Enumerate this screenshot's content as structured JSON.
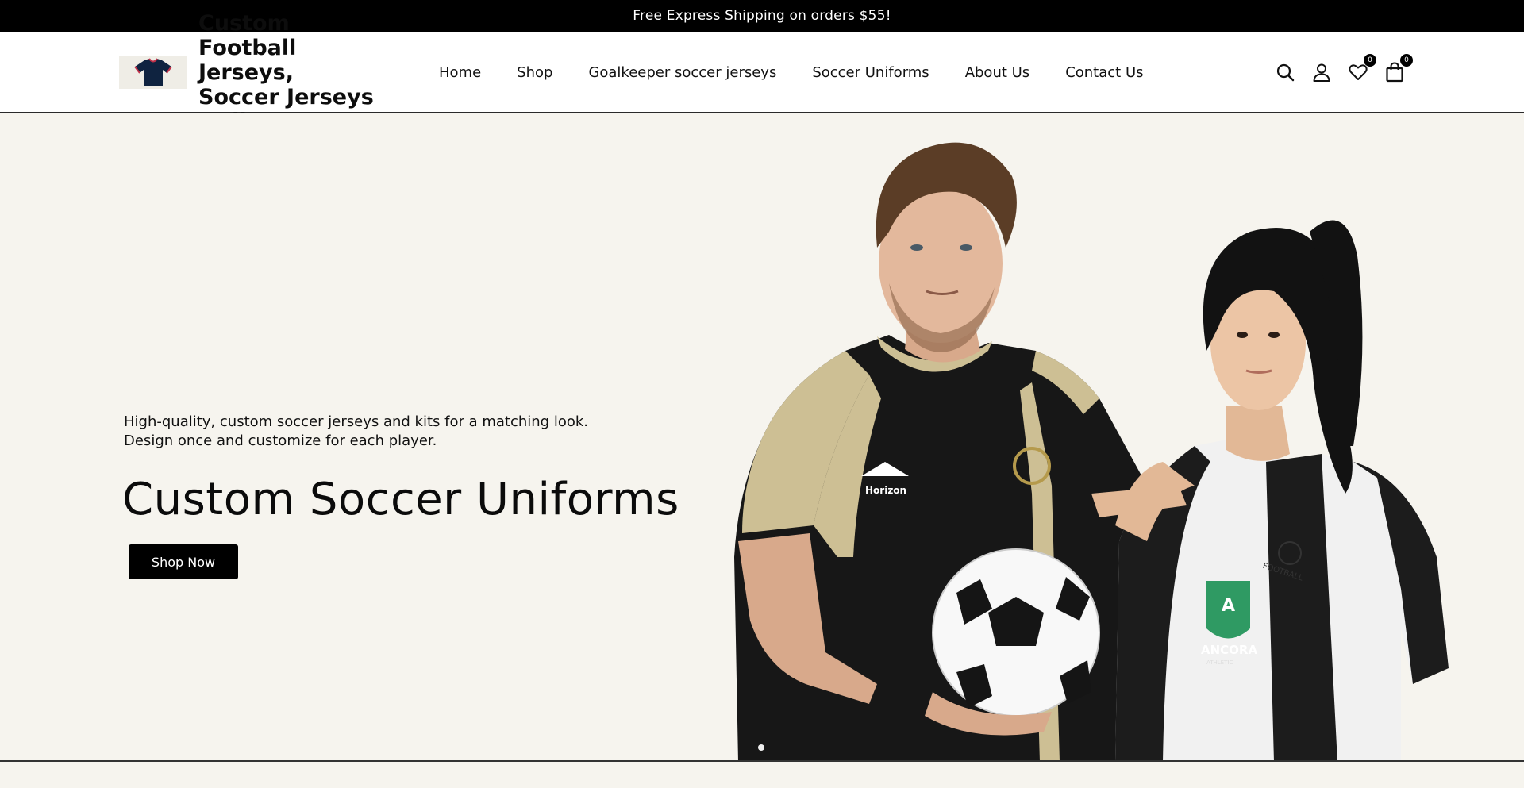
{
  "announcement": {
    "text": "Free Express Shipping on orders $55!"
  },
  "header": {
    "logo_text": "Custom Football Jerseys, Soccer Jerseys Online",
    "nav": [
      {
        "label": "Home"
      },
      {
        "label": "Shop"
      },
      {
        "label": "Goalkeeper soccer jerseys"
      },
      {
        "label": "Soccer Uniforms"
      },
      {
        "label": "About Us"
      },
      {
        "label": "Contact Us"
      }
    ],
    "icons": {
      "search": "search-icon",
      "account": "user-icon",
      "wishlist": "heart-icon",
      "cart": "bag-icon"
    },
    "wishlist_count": "0",
    "cart_count": "0"
  },
  "hero": {
    "subtitle_line1": "High-quality, custom soccer jerseys and kits for a matching look.",
    "subtitle_line2": "Design once and customize for each player.",
    "title": "Custom Soccer Uniforms",
    "cta_label": "Shop Now",
    "jersey_left": {
      "sponsor": "Horizon"
    },
    "jersey_right": {
      "badge_letter": "A",
      "badge_name": "ANCORA",
      "badge_sub": "ATHLETIC",
      "chest_text": "FOOTBALL"
    }
  },
  "colors": {
    "announcement_bg": "#000000",
    "hero_bg": "#f6f4ee",
    "button_bg": "#000000",
    "jersey_gold": "#cdbf94",
    "jersey_green": "#2f9a63"
  }
}
